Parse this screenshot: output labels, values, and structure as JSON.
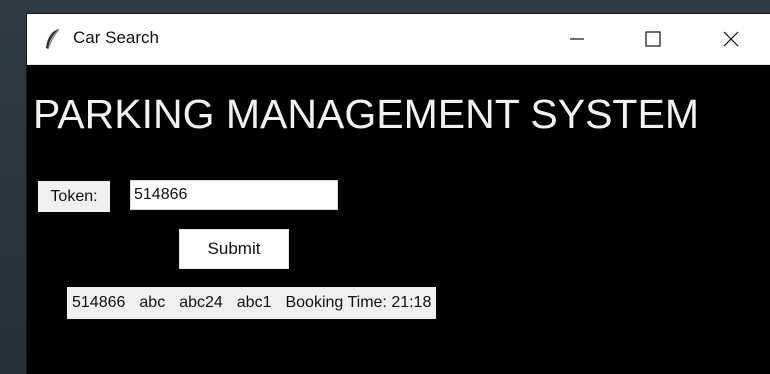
{
  "window": {
    "title": "Car Search",
    "icon": "feather-icon",
    "controls": {
      "minimize": "minimize-icon",
      "maximize": "maximize-icon",
      "close": "close-icon"
    }
  },
  "main": {
    "heading": "PARKING MANAGEMENT SYSTEM",
    "token_label": "Token:",
    "token_value": "514866",
    "submit_label": "Submit",
    "result": {
      "token": "514866",
      "field1": "abc",
      "field2": "abc24",
      "field3": "abc1",
      "booking": "Booking Time: 21:18"
    }
  },
  "colors": {
    "window_background": "#000000",
    "titlebar": "#ffffff",
    "heading_text": "#f2f2f2",
    "label_background": "#f0f0f0"
  }
}
